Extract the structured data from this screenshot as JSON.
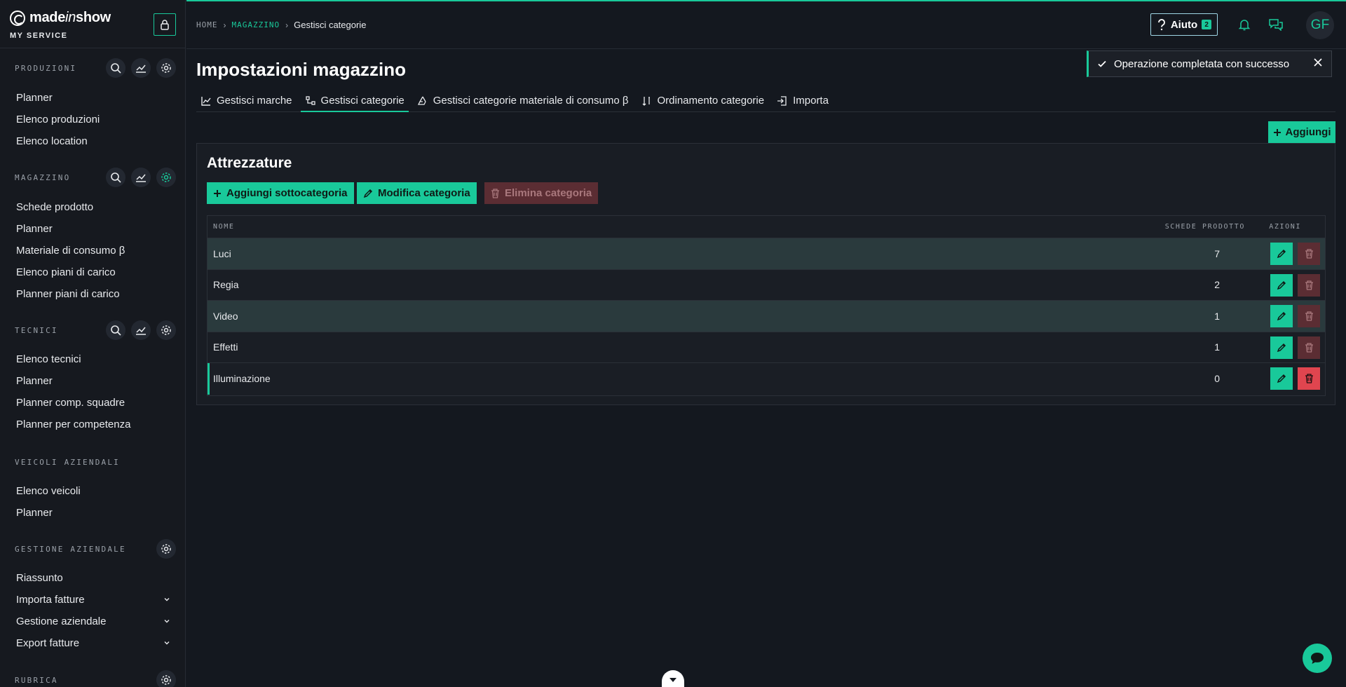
{
  "brand": {
    "name_prefix": "made",
    "name_italic": "in",
    "name_suffix": "show",
    "subtitle": "MY SERVICE"
  },
  "sidebar": {
    "sections": [
      {
        "title": "PRODUZIONI",
        "items": [
          "Planner",
          "Elenco produzioni",
          "Elenco location"
        ]
      },
      {
        "title": "MAGAZZINO",
        "items": [
          "Schede prodotto",
          "Planner",
          "Materiale di consumo β",
          "Elenco piani di carico",
          "Planner piani di carico"
        ]
      },
      {
        "title": "TECNICI",
        "items": [
          "Elenco tecnici",
          "Planner",
          "Planner comp. squadre",
          "Planner per competenza"
        ]
      },
      {
        "title": "VEICOLI AZIENDALI",
        "items": [
          "Elenco veicoli",
          "Planner"
        ]
      },
      {
        "title": "GESTIONE AZIENDALE",
        "items": [
          "Riassunto",
          "Importa fatture",
          "Gestione aziendale",
          "Export fatture"
        ]
      },
      {
        "title": "RUBRICA",
        "items": []
      }
    ]
  },
  "breadcrumb": {
    "home": "HOME",
    "section": "MAGAZZINO",
    "current": "Gestisci categorie"
  },
  "topbar": {
    "help_label": "Aiuto",
    "help_count": "2",
    "avatar_initials": "GF"
  },
  "page": {
    "title": "Impostazioni magazzino"
  },
  "toast": {
    "message": "Operazione completata con successo"
  },
  "tabs": [
    {
      "label": "Gestisci marche",
      "icon": "chart-icon",
      "active": false
    },
    {
      "label": "Gestisci categorie",
      "icon": "tree-icon",
      "active": true
    },
    {
      "label": "Gestisci categorie materiale di consumo β",
      "icon": "recycle-icon",
      "active": false
    },
    {
      "label": "Ordinamento categorie",
      "icon": "sort-icon",
      "active": false
    },
    {
      "label": "Importa",
      "icon": "import-icon",
      "active": false
    }
  ],
  "actions": {
    "add_label": "Aggiungi"
  },
  "panel": {
    "title": "Attrezzature",
    "add_sub_label": "Aggiungi sottocategoria",
    "edit_label": "Modifica categoria",
    "delete_label": "Elimina categoria"
  },
  "table": {
    "columns": {
      "name": "NOME",
      "count": "SCHEDE PRODOTTO",
      "actions": "AZIONI"
    },
    "rows": [
      {
        "name": "Luci",
        "count": "7"
      },
      {
        "name": "Regia",
        "count": "2"
      },
      {
        "name": "Video",
        "count": "1"
      },
      {
        "name": "Effetti",
        "count": "1"
      },
      {
        "name": "Illuminazione",
        "count": "0"
      }
    ]
  },
  "colors": {
    "accent": "#19c99a",
    "danger": "#e0454f",
    "background": "#14181f"
  }
}
